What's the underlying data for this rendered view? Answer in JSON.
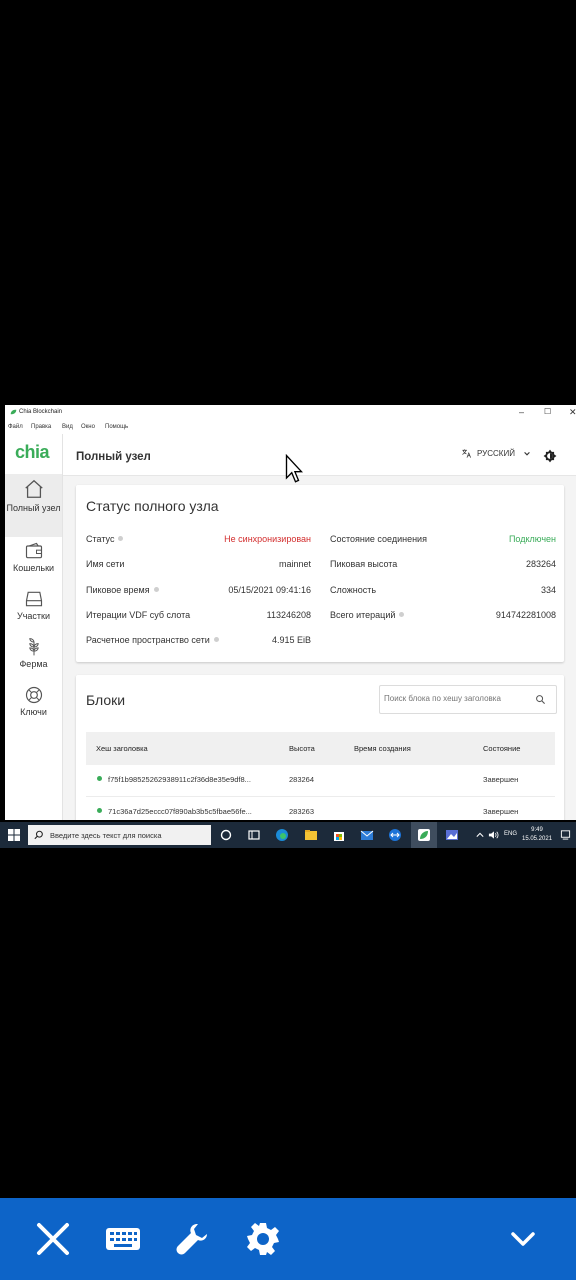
{
  "window": {
    "title": "Chia Blockchain",
    "controls": [
      "–",
      "☐",
      "✕"
    ]
  },
  "menu": [
    "Файл",
    "Правка",
    "Вид",
    "Окно",
    "Помощь"
  ],
  "sidebar": {
    "logo": "chia",
    "items": [
      {
        "label": "Полный узел",
        "icon": "home-icon",
        "active": true
      },
      {
        "label": "Кошельки",
        "icon": "wallet-icon"
      },
      {
        "label": "Участки",
        "icon": "plot-icon"
      },
      {
        "label": "Ферма",
        "icon": "farm-icon"
      },
      {
        "label": "Ключи",
        "icon": "keys-icon"
      }
    ]
  },
  "header": {
    "title": "Полный узел",
    "language": "РУССКИЙ"
  },
  "status": {
    "title": "Статус полного узла",
    "left": [
      {
        "label": "Статус",
        "value": "Не синхронизирован",
        "color": "#d32f2f",
        "info": true
      },
      {
        "label": "Имя сети",
        "value": "mainnet"
      },
      {
        "label": "Пиковое время",
        "value": "05/15/2021 09:41:16",
        "info": true
      },
      {
        "label": "Итерации VDF суб слота",
        "value": "113246208"
      },
      {
        "label": "Расчетное пространство сети",
        "value": "4.915 EiB",
        "info": true
      }
    ],
    "right": [
      {
        "label": "Состояние соединения",
        "value": "Подключен",
        "color": "#3aac59"
      },
      {
        "label": "Пиковая высота",
        "value": "283264"
      },
      {
        "label": "Сложность",
        "value": "334"
      },
      {
        "label": "Всего итераций",
        "value": "914742281008",
        "info": true
      }
    ]
  },
  "blocks": {
    "title": "Блоки",
    "search_placeholder": "Поиск блока по хешу заголовка",
    "columns": [
      "Хеш заголовка",
      "Высота",
      "Время создания",
      "Состояние"
    ],
    "rows": [
      {
        "hash": "f75f1b98525262938911c2f36d8e35e9df8...",
        "height": "283264",
        "time": "",
        "state": "Завершен"
      },
      {
        "hash": "71c36a7d25eccc07f890ab3b5c5fbae56fe...",
        "height": "283263",
        "time": "",
        "state": "Завершен"
      }
    ]
  },
  "taskbar": {
    "search_placeholder": "Введите здесь текст для поиска",
    "lang": "ENG",
    "time": "9:49",
    "date": "15.05.2021"
  },
  "bottom_toolbar": [
    "close-icon",
    "keyboard-icon",
    "wrench-icon",
    "gear-icon",
    "chevron-down-icon"
  ]
}
